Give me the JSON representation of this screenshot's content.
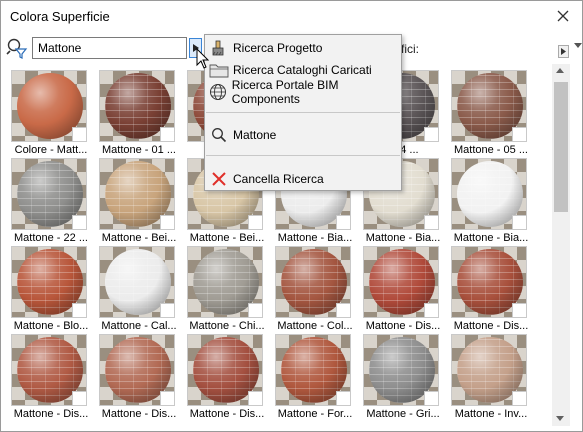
{
  "window": {
    "title": "Colora Superficie"
  },
  "search": {
    "value": "Mattone",
    "partial_label": "fici:"
  },
  "menu": {
    "items": [
      {
        "label": "Ricerca Progetto",
        "icon": "brush-icon"
      },
      {
        "label": "Ricerca Cataloghi Caricati",
        "icon": "folder-icon"
      },
      {
        "label": "Ricerca Portale BIM Components",
        "icon": "globe-icon"
      },
      {
        "label": "Mattone",
        "icon": "magnifier-icon"
      },
      {
        "label": "Cancella Ricerca",
        "icon": "red-x-icon"
      }
    ]
  },
  "materials": [
    {
      "label": "Colore - Matt...",
      "color": "#c96a48"
    },
    {
      "label": "Mattone - 01 ...",
      "color": "#7a4034"
    },
    {
      "label": "Ma",
      "color": "#8e4a3a"
    },
    {
      "label": "",
      "color": "#a45a48"
    },
    {
      "label": "- 04 ...",
      "color": "#5c5658"
    },
    {
      "label": "Mattone - 05 ...",
      "color": "#8a5a4a"
    },
    {
      "label": "Mattone - 22 ...",
      "color": "#8f8f8d"
    },
    {
      "label": "Mattone - Bei...",
      "color": "#c8a47c"
    },
    {
      "label": "Mattone - Bei...",
      "color": "#d8c6a6"
    },
    {
      "label": "Mattone - Bia...",
      "color": "#ececec"
    },
    {
      "label": "Mattone - Bia...",
      "color": "#e2ddd0"
    },
    {
      "label": "Mattone - Bia...",
      "color": "#f2f2f2"
    },
    {
      "label": "Mattone - Blo...",
      "color": "#b8563a"
    },
    {
      "label": "Mattone - Cal...",
      "color": "#ececec"
    },
    {
      "label": "Mattone - Chi...",
      "color": "#a09c94"
    },
    {
      "label": "Mattone - Col...",
      "color": "#a45640"
    },
    {
      "label": "Mattone - Dis...",
      "color": "#b04a3a"
    },
    {
      "label": "Mattone - Dis...",
      "color": "#a8503c"
    },
    {
      "label": "Mattone - Dis...",
      "color": "#b05a44"
    },
    {
      "label": "Mattone - Dis...",
      "color": "#b26a54"
    },
    {
      "label": "Mattone - Dis...",
      "color": "#a45040"
    },
    {
      "label": "Mattone - For...",
      "color": "#b0583e"
    },
    {
      "label": "Mattone - Gri...",
      "color": "#8e8e8e"
    },
    {
      "label": "Mattone - Inv...",
      "color": "#c4a08a"
    }
  ]
}
